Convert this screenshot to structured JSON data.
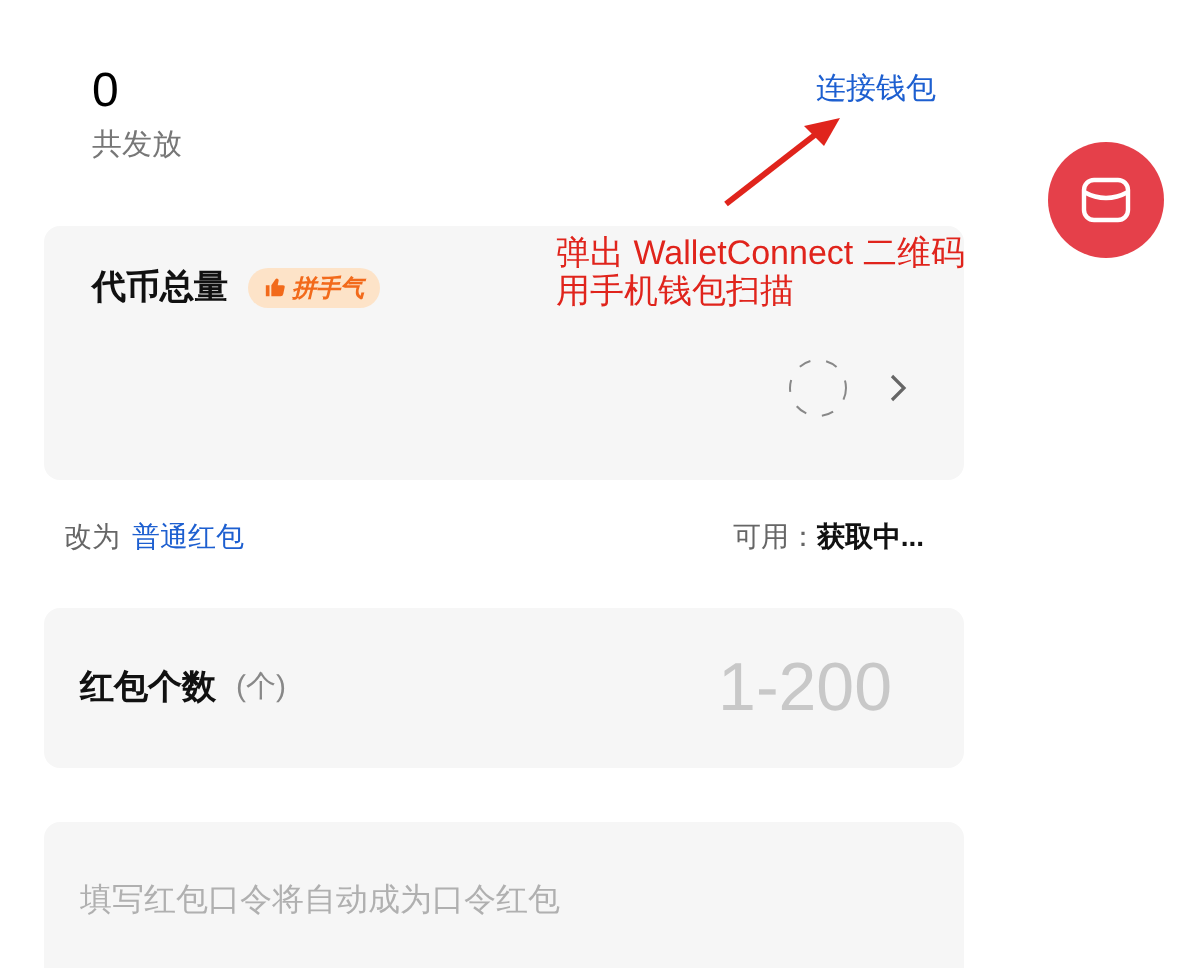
{
  "summary": {
    "value": "0",
    "label": "共发放",
    "connect_link": "连接钱包"
  },
  "annotation": {
    "lines": [
      "弹出 WalletConnect 二维码",
      "用手机钱包扫描"
    ]
  },
  "token_total": {
    "label": "代币总量",
    "badge": "拼手气",
    "loading": true
  },
  "switch_row": {
    "prefix": "改为",
    "link": "普通红包",
    "available_label": "可用：",
    "available_value": "获取中..."
  },
  "count_field": {
    "label": "红包个数",
    "unit": "(个)",
    "placeholder": "1-200"
  },
  "password_field": {
    "placeholder": "填写红包口令将自动成为口令红包"
  }
}
